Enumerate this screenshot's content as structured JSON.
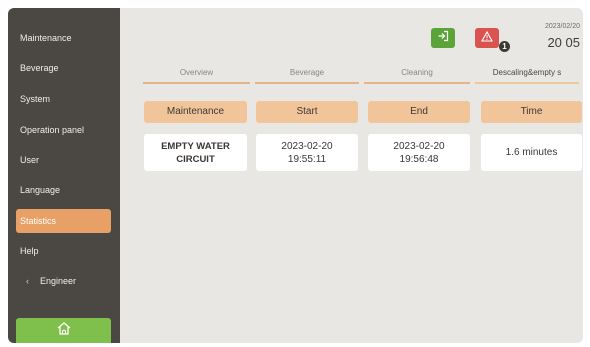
{
  "sidebar": {
    "items": [
      {
        "label": "Maintenance"
      },
      {
        "label": "Beverage"
      },
      {
        "label": "System"
      },
      {
        "label": "Operation panel"
      },
      {
        "label": "User"
      },
      {
        "label": "Language"
      },
      {
        "label": "Statistics",
        "active": true
      },
      {
        "label": "Help"
      },
      {
        "label": "Engineer",
        "chevron": "‹"
      }
    ],
    "home_icon": "home-icon"
  },
  "header": {
    "exit_icon": "exit-icon",
    "alarm_icon": "warning-icon",
    "alarm_count": "1",
    "date": "2023/02/20",
    "time": "20 05"
  },
  "tabs": [
    {
      "label": "Overview"
    },
    {
      "label": "Beverage"
    },
    {
      "label": "Cleaning"
    },
    {
      "label": "Descaling&empty s",
      "active": true
    }
  ],
  "table": {
    "headers": [
      "Maintenance",
      "Start",
      "End",
      "Time"
    ],
    "rows": [
      [
        "EMPTY WATER\nCIRCUIT",
        "2023-02-20\n19:55:11",
        "2023-02-20\n19:56:48",
        "1.6 minutes"
      ]
    ]
  },
  "colors": {
    "sidebar_bg": "#4b4742",
    "active_item": "#e9a066",
    "home_button": "#7fbf4c",
    "exit_button": "#5aa43a",
    "alarm_button": "#d9534f",
    "table_header": "#f1c49a"
  }
}
